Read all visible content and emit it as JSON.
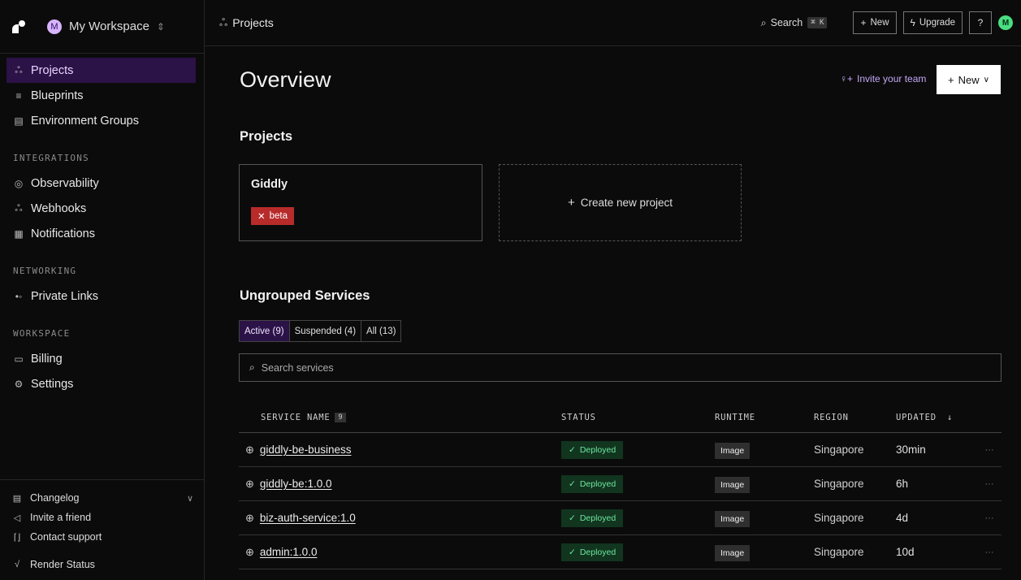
{
  "workspace": {
    "avatar": "M",
    "name": "My Workspace"
  },
  "sidebar": {
    "top_items": [
      {
        "label": "Projects",
        "icon": "projects-icon"
      },
      {
        "label": "Blueprints",
        "icon": "blueprints-icon"
      },
      {
        "label": "Environment Groups",
        "icon": "env-groups-icon"
      }
    ],
    "sections": [
      {
        "title": "INTEGRATIONS",
        "items": [
          {
            "label": "Observability",
            "icon": "observability-icon"
          },
          {
            "label": "Webhooks",
            "icon": "webhooks-icon"
          },
          {
            "label": "Notifications",
            "icon": "notifications-icon"
          }
        ]
      },
      {
        "title": "NETWORKING",
        "items": [
          {
            "label": "Private Links",
            "icon": "private-links-icon"
          }
        ]
      },
      {
        "title": "WORKSPACE",
        "items": [
          {
            "label": "Billing",
            "icon": "billing-icon"
          },
          {
            "label": "Settings",
            "icon": "settings-icon"
          }
        ]
      }
    ],
    "footer": [
      {
        "label": "Changelog"
      },
      {
        "label": "Invite a friend"
      },
      {
        "label": "Contact support"
      },
      {
        "label": "Render Status"
      }
    ]
  },
  "topbar": {
    "breadcrumb": "Projects",
    "search_label": "Search",
    "search_kbd": "⌘ K",
    "new_label": "New",
    "upgrade_label": "Upgrade",
    "user_avatar": "M"
  },
  "main": {
    "title": "Overview",
    "invite_label": "Invite your team",
    "new_label": "New",
    "projects_heading": "Projects",
    "project": {
      "name": "Giddly",
      "badge": "beta"
    },
    "create_label": "Create new project",
    "services_heading": "Ungrouped Services",
    "filters": [
      "Active (9)",
      "Suspended (4)",
      "All (13)"
    ],
    "search_placeholder": "Search services",
    "table": {
      "headers": {
        "name": "SERVICE NAME",
        "count": "9",
        "status": "STATUS",
        "runtime": "RUNTIME",
        "region": "REGION",
        "updated": "UPDATED"
      },
      "rows": [
        {
          "name": "giddly-be-business",
          "status": "Deployed",
          "runtime": "Image",
          "region": "Singapore",
          "updated": "30min"
        },
        {
          "name": "giddly-be:1.0.0",
          "status": "Deployed",
          "runtime": "Image",
          "region": "Singapore",
          "updated": "6h"
        },
        {
          "name": "biz-auth-service:1.0",
          "status": "Deployed",
          "runtime": "Image",
          "region": "Singapore",
          "updated": "4d"
        },
        {
          "name": "admin:1.0.0",
          "status": "Deployed",
          "runtime": "Image",
          "region": "Singapore",
          "updated": "10d"
        }
      ]
    }
  }
}
